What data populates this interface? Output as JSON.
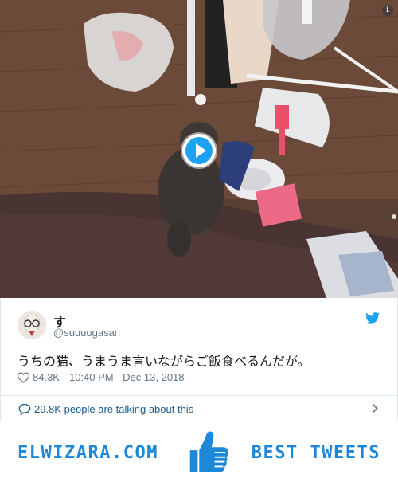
{
  "media": {
    "info_icon": "i",
    "play_icon": "play-icon"
  },
  "tweet": {
    "display_name": "す",
    "handle": "@suuuugasan",
    "text": "うちの猫、うまうま言いながらご飯食べるんだが。",
    "likes": "84.3K",
    "timestamp": "10:40 PM - Dec 13, 2018",
    "talking": "29.8K people are talking about this"
  },
  "banner": {
    "left": "ELWIZARA.COM",
    "right": "BEST TWEETS"
  },
  "colors": {
    "twitter_blue": "#1da1f2",
    "brand_blue": "#1e88d8",
    "link": "#1b5a8c",
    "muted": "#657786"
  }
}
